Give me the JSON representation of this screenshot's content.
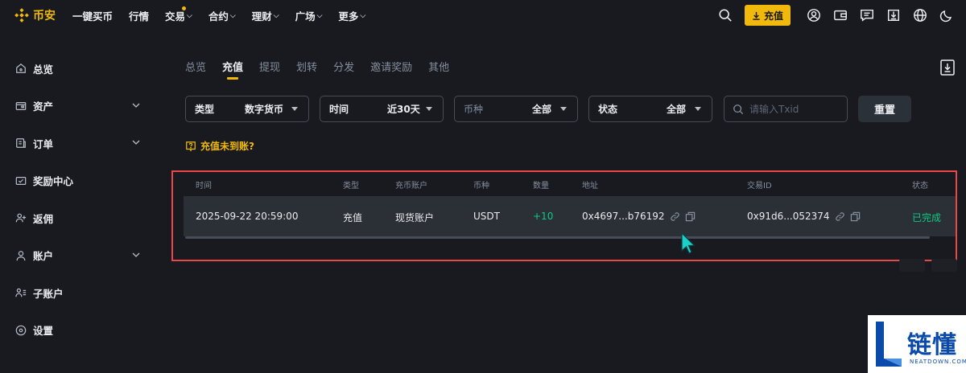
{
  "brand": {
    "name": "币安",
    "color": "#f0b90b"
  },
  "nav": {
    "items": [
      {
        "label": "一键买币",
        "chevron": false,
        "dot": false
      },
      {
        "label": "行情",
        "chevron": false,
        "dot": false
      },
      {
        "label": "交易",
        "chevron": true,
        "dot": true
      },
      {
        "label": "合约",
        "chevron": true,
        "dot": false
      },
      {
        "label": "理财",
        "chevron": true,
        "dot": false
      },
      {
        "label": "广场",
        "chevron": true,
        "dot": false
      },
      {
        "label": "更多",
        "chevron": true,
        "dot": false
      }
    ],
    "deposit_label": "充值",
    "icons": [
      "search-icon",
      "user-icon",
      "wallet-icon",
      "message-icon",
      "download-icon",
      "globe-icon",
      "moon-icon"
    ]
  },
  "sidebar": {
    "items": [
      {
        "label": "总览",
        "icon": "home-icon",
        "expandable": false
      },
      {
        "label": "资产",
        "icon": "wallet-icon",
        "expandable": true
      },
      {
        "label": "订单",
        "icon": "order-icon",
        "expandable": true
      },
      {
        "label": "奖励中心",
        "icon": "reward-icon",
        "expandable": false
      },
      {
        "label": "返佣",
        "icon": "referral-icon",
        "expandable": false
      },
      {
        "label": "账户",
        "icon": "account-icon",
        "expandable": true
      },
      {
        "label": "子账户",
        "icon": "subaccount-icon",
        "expandable": false
      },
      {
        "label": "设置",
        "icon": "settings-icon",
        "expandable": false
      }
    ]
  },
  "tabs": [
    {
      "label": "总览",
      "active": false
    },
    {
      "label": "充值",
      "active": true
    },
    {
      "label": "提现",
      "active": false
    },
    {
      "label": "划转",
      "active": false
    },
    {
      "label": "分发",
      "active": false
    },
    {
      "label": "邀请奖励",
      "active": false
    },
    {
      "label": "其他",
      "active": false
    }
  ],
  "filters": {
    "type": {
      "label": "类型",
      "value": "数字货币"
    },
    "time": {
      "label": "时间",
      "value": "近30天"
    },
    "coin": {
      "label": "币种",
      "value": "全部"
    },
    "status": {
      "label": "状态",
      "value": "全部"
    },
    "search_placeholder": "请输入Txid",
    "reset_label": "重置"
  },
  "not_arrived_label": "充值未到账?",
  "table": {
    "headers": [
      "时间",
      "类型",
      "充币账户",
      "币种",
      "数量",
      "地址",
      "交易ID",
      "状态"
    ],
    "rows": [
      {
        "time": "2025-09-22 20:59:00",
        "type": "充值",
        "account": "现货账户",
        "coin": "USDT",
        "amount": "+10",
        "address": "0x4697...b76192",
        "txid": "0x91d6...052374",
        "status": "已完成"
      }
    ]
  },
  "watermark": {
    "text": "链懂",
    "sub": "NEATDOWN.COM"
  }
}
